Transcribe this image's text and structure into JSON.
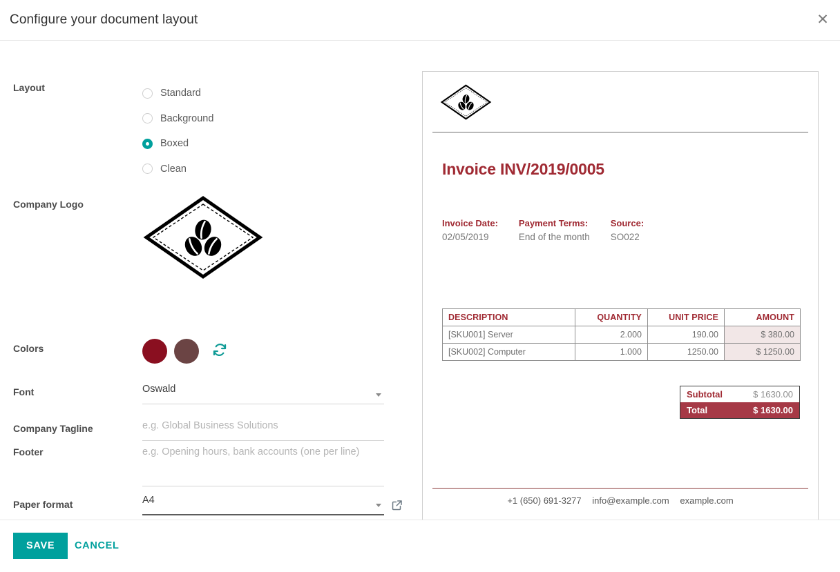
{
  "dialog": {
    "title": "Configure your document layout",
    "close_icon": "close-icon"
  },
  "form": {
    "layout": {
      "label": "Layout",
      "options": [
        {
          "label": "Standard",
          "selected": false
        },
        {
          "label": "Background",
          "selected": false
        },
        {
          "label": "Boxed",
          "selected": true
        },
        {
          "label": "Clean",
          "selected": false
        }
      ]
    },
    "company_logo": {
      "label": "Company Logo",
      "image": "diamond-coffee-beans-logo"
    },
    "colors": {
      "label": "Colors",
      "primary": "#8a0f20",
      "secondary": "#6b4444",
      "reset_icon": "refresh-icon"
    },
    "font": {
      "label": "Font",
      "value": "Oswald"
    },
    "company_tagline": {
      "label": "Company Tagline",
      "value": "",
      "placeholder": "e.g. Global Business Solutions"
    },
    "footer_field": {
      "label": "Footer",
      "value": "",
      "placeholder": "e.g. Opening hours, bank accounts (one per line)"
    },
    "paper_format": {
      "label": "Paper format",
      "value": "A4",
      "external_icon": "external-link-icon"
    }
  },
  "preview": {
    "logo": "diamond-coffee-beans-logo",
    "title": "Invoice INV/2019/0005",
    "meta": [
      {
        "label": "Invoice Date:",
        "value": "02/05/2019"
      },
      {
        "label": "Payment Terms:",
        "value": "End of the month"
      },
      {
        "label": "Source:",
        "value": "SO022"
      }
    ],
    "table": {
      "headers": [
        "DESCRIPTION",
        "QUANTITY",
        "UNIT PRICE",
        "AMOUNT"
      ],
      "rows": [
        {
          "description": "[SKU001] Server",
          "quantity": "2.000",
          "unit_price": "190.00",
          "amount": "$ 380.00"
        },
        {
          "description": "[SKU002] Computer",
          "quantity": "1.000",
          "unit_price": "1250.00",
          "amount": "$ 1250.00"
        }
      ]
    },
    "totals": {
      "subtotal_label": "Subtotal",
      "subtotal_value": "$ 1630.00",
      "total_label": "Total",
      "total_value": "$ 1630.00",
      "total_bg": "#a63946"
    },
    "footer": {
      "phone": "+1 (650) 691-3277",
      "email": "info@example.com",
      "website": "example.com"
    }
  },
  "buttons": {
    "save": "SAVE",
    "cancel": "CANCEL",
    "accent": "#00a09d"
  }
}
